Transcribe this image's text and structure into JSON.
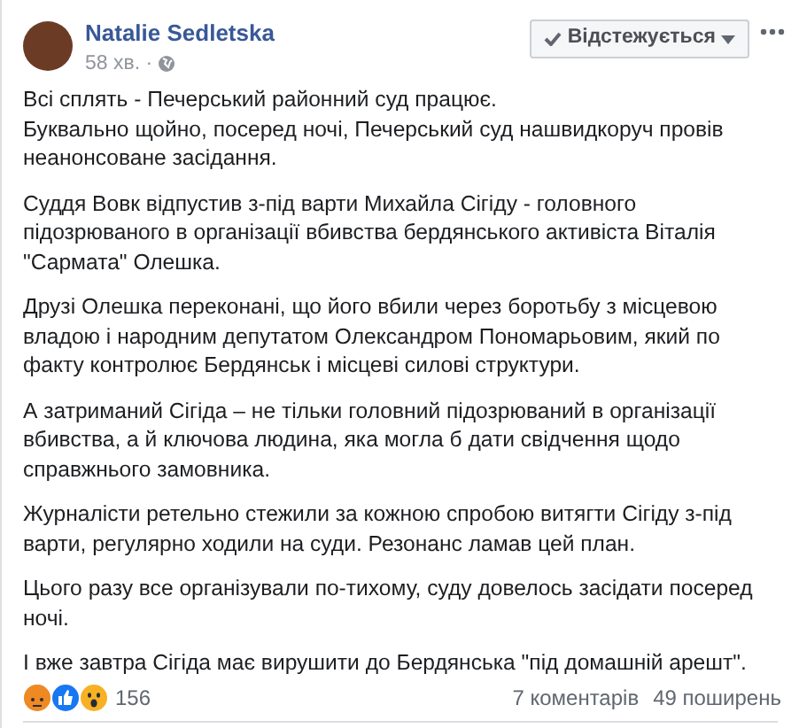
{
  "post": {
    "author": "Natalie Sedletska",
    "time": "58 хв. ·",
    "follow_button": {
      "label": "Відстежується",
      "checked": true
    },
    "paragraphs": [
      "Всі сплять - Печерський районний суд працює.\nБуквально щойно, посеред ночі, Печерський суд нашвидкоруч провів неанонсоване засідання.",
      "Суддя Вовк відпустив з-під варти Михайла Сігіду - головного підозрюваного в організації вбивства бердянського активіста Віталія \"Сармата\" Олешка.",
      "Друзі Олешка переконані, що його вбили через боротьбу з місцевою владою і народним депутатом Олександром Пономарьовим, який по факту контролює Бердянськ і місцеві силові структури.",
      "А затриманий Сігіда – не тільки головний підозрюваний в організації вбивства, а й ключова людина, яка могла б дати свідчення щодо справжнього замовника.",
      "Журналісти ретельно стежили за кожною спробою витягти Сігіду з-під варти, регулярно ходили на суди. Резонанс ламав цей план.",
      "Цього разу все організували по-тихому, суду довелось засідати посеред ночі.",
      "І вже завтра Сігіда має вирушити до Бердянська \"під домашній арешт\"."
    ],
    "reactions": {
      "items": [
        {
          "kind": "angry"
        },
        {
          "kind": "like"
        },
        {
          "kind": "wow"
        }
      ],
      "count": "156"
    },
    "comments": "7 коментарів",
    "shares": "49 поширень"
  }
}
